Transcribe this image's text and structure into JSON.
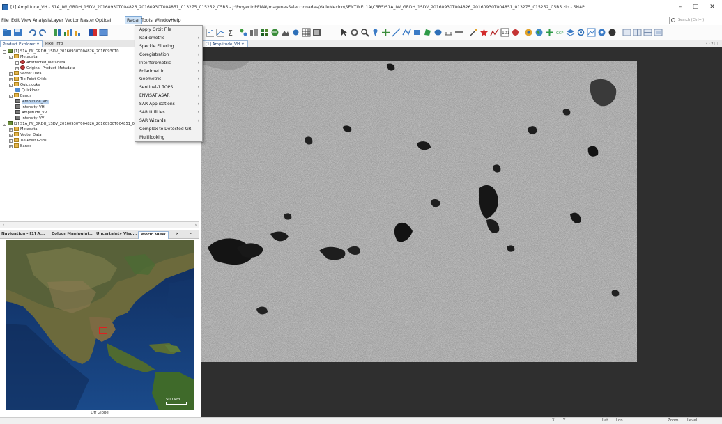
{
  "window": {
    "title": "[1] Amplitude_VH - S1A_IW_GRDH_1SDV_20160930T004826_20160930T004851_013275_015252_C5B5 - J:\\ProyectoPEMA\\ImagenesSeleccionadas\\ValleMexico\\SENTINEL1A\\C5B5\\S1A_IW_GRDH_1SDV_20160930T004826_20160930T004851_013275_015252_C5B5.zip - SNAP",
    "minimize": "–",
    "maximize": "□",
    "close": "✕"
  },
  "menubar": {
    "items": [
      "File",
      "Edit",
      "View",
      "Analysis",
      "Layer",
      "Vector",
      "Raster",
      "Optical",
      "Radar",
      "Tools",
      "Window",
      "Help"
    ],
    "active": "Radar"
  },
  "search": {
    "placeholder": "Search (Ctrl+I)"
  },
  "radar_menu": {
    "items": [
      {
        "label": "Apply Orbit File",
        "submenu": false
      },
      {
        "label": "Radiometric",
        "submenu": true
      },
      {
        "label": "Speckle Filtering",
        "submenu": true
      },
      {
        "label": "Coregistration",
        "submenu": true
      },
      {
        "label": "Interferometric",
        "submenu": true
      },
      {
        "label": "Polarimetric",
        "submenu": true
      },
      {
        "label": "Geometric",
        "submenu": true
      },
      {
        "label": "Sentinel-1 TOPS",
        "submenu": true
      },
      {
        "label": "ENVISAT ASAR",
        "submenu": true
      },
      {
        "label": "SAR Applications",
        "submenu": true
      },
      {
        "label": "SAR Utilities",
        "submenu": true
      },
      {
        "label": "SAR Wizards",
        "submenu": true
      },
      {
        "label": "Complex to Detected GR",
        "submenu": false
      },
      {
        "label": "Multilooking",
        "submenu": false
      }
    ],
    "arrow": "›"
  },
  "product_explorer": {
    "tabs": [
      "Product Explorer",
      "Pixel Info"
    ],
    "close": "×",
    "tree": [
      {
        "label": "[1] S1A_IW_GRDH_1SDV_20160930T004826_20160930T0",
        "icon": "prod",
        "indent": 0,
        "exp": "-"
      },
      {
        "label": "Metadata",
        "icon": "folder",
        "indent": 1,
        "exp": "-"
      },
      {
        "label": "Abstracted_Metadata",
        "icon": "red",
        "indent": 2,
        "exp": "+"
      },
      {
        "label": "Original_Product_Metadata",
        "icon": "red",
        "indent": 2,
        "exp": "+"
      },
      {
        "label": "Vector Data",
        "icon": "folder",
        "indent": 1,
        "exp": "+"
      },
      {
        "label": "Tie-Point Grids",
        "icon": "folder",
        "indent": 1,
        "exp": "+"
      },
      {
        "label": "Quicklooks",
        "icon": "folder",
        "indent": 1,
        "exp": "-"
      },
      {
        "label": "Quicklook",
        "icon": "ql",
        "indent": 2,
        "exp": ""
      },
      {
        "label": "Bands",
        "icon": "folder",
        "indent": 1,
        "exp": "-"
      },
      {
        "label": "Amplitude_VH",
        "icon": "band",
        "indent": 2,
        "exp": "",
        "selected": true
      },
      {
        "label": "Intensity_VH",
        "icon": "band",
        "indent": 2,
        "exp": ""
      },
      {
        "label": "Amplitude_VV",
        "icon": "band",
        "indent": 2,
        "exp": ""
      },
      {
        "label": "Intensity_VV",
        "icon": "band",
        "indent": 2,
        "exp": ""
      },
      {
        "label": "[2] S1A_IW_GRDH_1SDV_20160930T004826_20160930T004851_013275_015252_C5B5_Or",
        "icon": "prod",
        "indent": 0,
        "exp": "-"
      },
      {
        "label": "Metadata",
        "icon": "folder",
        "indent": 1,
        "exp": "+"
      },
      {
        "label": "Vector Data",
        "icon": "folder",
        "indent": 1,
        "exp": "+"
      },
      {
        "label": "Tie-Point Grids",
        "icon": "folder",
        "indent": 1,
        "exp": "+"
      },
      {
        "label": "Bands",
        "icon": "folder",
        "indent": 1,
        "exp": "+"
      }
    ]
  },
  "navigation": {
    "tabs": [
      "Navigation - [1] A...",
      "Colour Manipulat...",
      "Uncertainty Visu...",
      "World View"
    ],
    "close": "×",
    "minimize": "–",
    "scale_label": "500 km",
    "footer": "Off Globe"
  },
  "image_tab": {
    "label": "[1] Amplitude_VH",
    "close": "×",
    "nav": "‹  ›  ▾  □"
  },
  "statusbar": {
    "items": [
      "X",
      "Y",
      "Lat",
      "Lon",
      "Zoom",
      "Level"
    ]
  },
  "colors": {
    "accent": "#cfe3f7",
    "viewport_bg": "#2f2f2f",
    "menu_bg": "#f2f2f2",
    "selection": "#b9d2ee"
  }
}
